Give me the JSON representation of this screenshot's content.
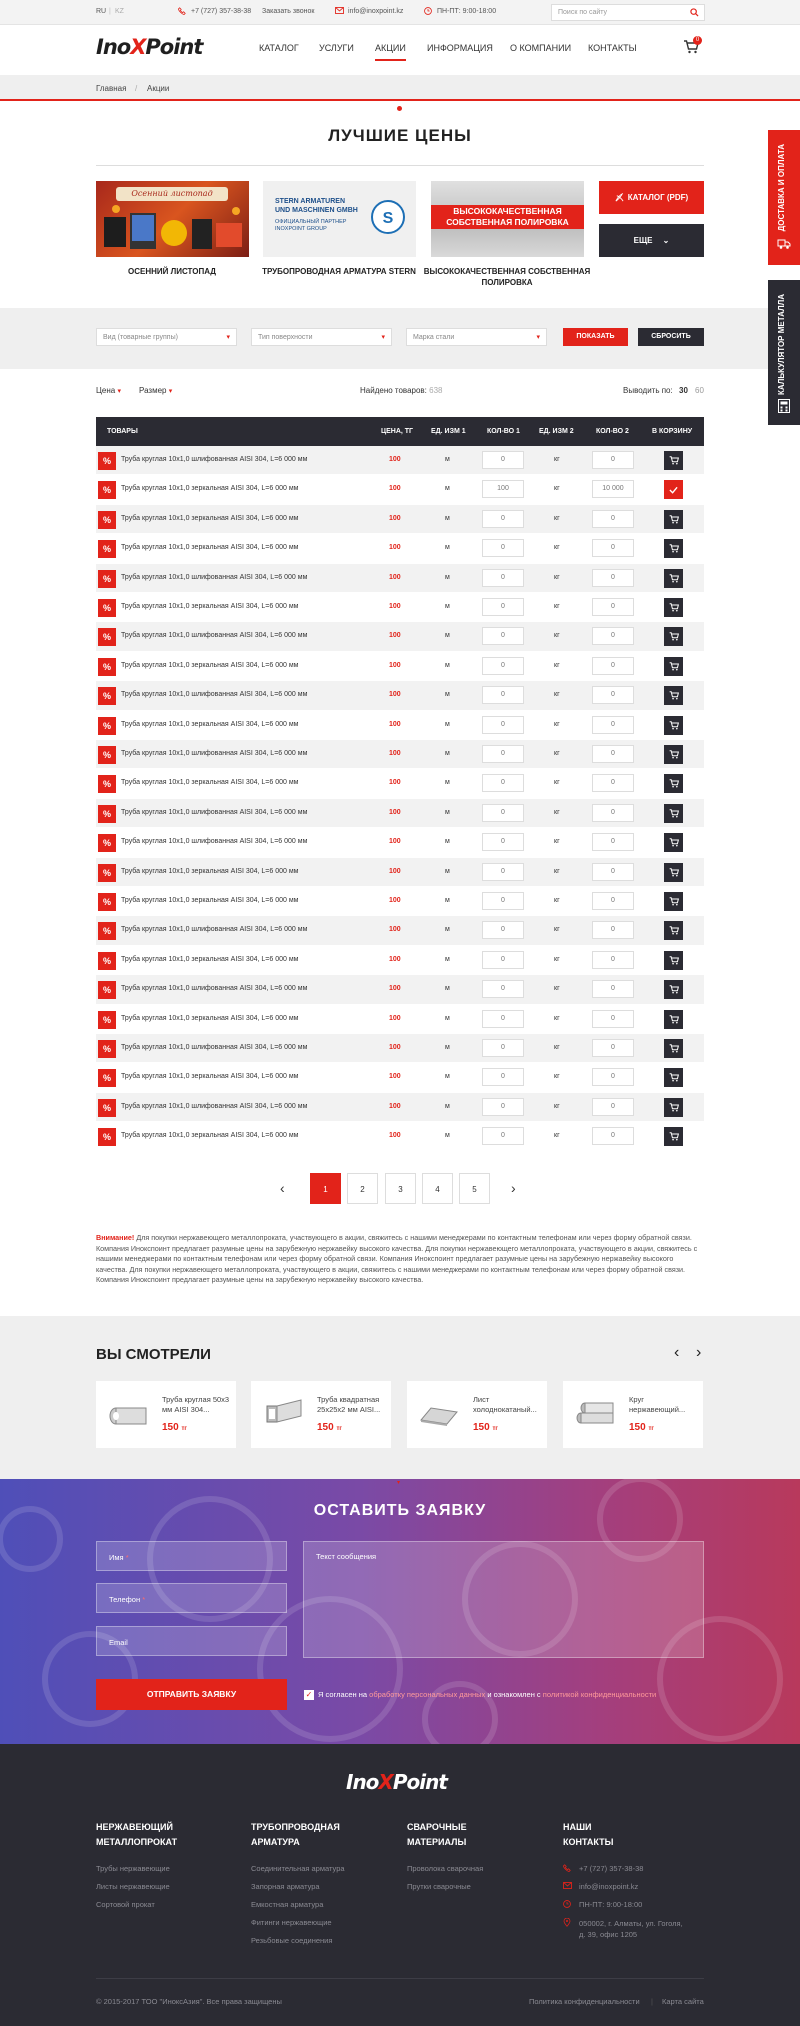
{
  "topbar": {
    "lang_ru": "RU",
    "lang_kz": "KZ",
    "phone": "+7 (727) 357-38-38",
    "callback": "Заказать звонок",
    "email": "info@inoxpoint.kz",
    "hours": "ПН-ПТ: 9:00-18:00",
    "search_placeholder": "Поиск по сайту"
  },
  "logo": {
    "part1": "Ino",
    "x": "X",
    "part2": "Point"
  },
  "nav": [
    "КАТАЛОГ",
    "УСЛУГИ",
    "АКЦИИ",
    "ИНФОРМАЦИЯ",
    "О КОМПАНИИ",
    "КОНТАКТЫ"
  ],
  "cart_count": "0",
  "breadcrumb": {
    "home": "Главная",
    "current": "Акции"
  },
  "page_title": "ЛУЧШИЕ ЦЕНЫ",
  "promos": [
    {
      "caption": "ОСЕННИЙ ЛИСТОПАД",
      "image_text": "Осенний листопад"
    },
    {
      "caption": "ТРУБОПРОВОДНАЯ АРМАТУРА STERN",
      "image_text_1": "STERN ARMATUREN",
      "image_text_2": "UND MASCHINEN GMBH",
      "image_text_3": "ОФИЦИАЛЬНЫЙ ПАРТНЕР",
      "image_text_4": "INOXPOINT GROUP"
    },
    {
      "caption": "ВЫСОКОКАЧЕСТВЕННАЯ СОБСТВЕННАЯ ПОЛИРОВКА",
      "image_text": "ВЫСОКОКАЧЕСТВЕННАЯ СОБСТВЕННАЯ ПОЛИРОВКА"
    }
  ],
  "catalog_button": "КАТАЛОГ (PDF)",
  "more_button": "ЕЩЕ",
  "filters": {
    "group_placeholder": "Вид (товарные группы)",
    "surface_placeholder": "Тип поверхности",
    "steel_placeholder": "Марка стали",
    "show_button": "ПОКАЗАТЬ",
    "reset_button": "СБРОСИТЬ"
  },
  "sort": {
    "price": "Цена",
    "size": "Размер",
    "found_label": "Найдено товаров:",
    "found_count": "638",
    "per_page_label": "Выводить по:",
    "per_page_30": "30",
    "per_page_60": "60"
  },
  "table": {
    "headers": [
      "ТОВАРЫ",
      "ЦЕНА, ТГ",
      "ЕД. ИЗМ 1",
      "КОЛ-ВО 1",
      "ЕД. ИЗМ 2",
      "КОЛ-ВО 2",
      "В КОРЗИНУ"
    ],
    "badge": "%",
    "rows": [
      {
        "name": "Труба круглая 10х1,0 шлифованная AISI 304, L=6 000 мм",
        "price": "100",
        "u1": "м",
        "q1": "0",
        "u2": "кг",
        "q2": "0",
        "in_cart": false
      },
      {
        "name": "Труба круглая 10х1,0 зеркальная AISI 304, L=6 000 мм",
        "price": "100",
        "u1": "м",
        "q1": "100",
        "u2": "кг",
        "q2": "10 000",
        "in_cart": true
      },
      {
        "name": "Труба круглая 10х1,0 зеркальная AISI 304, L=6 000 мм",
        "price": "100",
        "u1": "м",
        "q1": "0",
        "u2": "кг",
        "q2": "0",
        "in_cart": false
      },
      {
        "name": "Труба круглая 10х1,0 зеркальная AISI 304, L=6 000 мм",
        "price": "100",
        "u1": "м",
        "q1": "0",
        "u2": "кг",
        "q2": "0",
        "in_cart": false
      },
      {
        "name": "Труба круглая 10х1,0 шлифованная AISI 304, L=6 000 мм",
        "price": "100",
        "u1": "м",
        "q1": "0",
        "u2": "кг",
        "q2": "0",
        "in_cart": false
      },
      {
        "name": "Труба круглая 10х1,0 зеркальная AISI 304, L=6 000 мм",
        "price": "100",
        "u1": "м",
        "q1": "0",
        "u2": "кг",
        "q2": "0",
        "in_cart": false
      },
      {
        "name": "Труба круглая 10х1,0 шлифованная AISI 304, L=6 000 мм",
        "price": "100",
        "u1": "м",
        "q1": "0",
        "u2": "кг",
        "q2": "0",
        "in_cart": false
      },
      {
        "name": "Труба круглая 10х1,0 зеркальная AISI 304, L=6 000 мм",
        "price": "100",
        "u1": "м",
        "q1": "0",
        "u2": "кг",
        "q2": "0",
        "in_cart": false
      },
      {
        "name": "Труба круглая 10х1,0 шлифованная AISI 304, L=6 000 мм",
        "price": "100",
        "u1": "м",
        "q1": "0",
        "u2": "кг",
        "q2": "0",
        "in_cart": false
      },
      {
        "name": "Труба круглая 10х1,0 зеркальная AISI 304, L=6 000 мм",
        "price": "100",
        "u1": "м",
        "q1": "0",
        "u2": "кг",
        "q2": "0",
        "in_cart": false
      },
      {
        "name": "Труба круглая 10х1,0 шлифованная AISI 304, L=6 000 мм",
        "price": "100",
        "u1": "м",
        "q1": "0",
        "u2": "кг",
        "q2": "0",
        "in_cart": false
      },
      {
        "name": "Труба круглая 10х1,0 зеркальная AISI 304, L=6 000 мм",
        "price": "100",
        "u1": "м",
        "q1": "0",
        "u2": "кг",
        "q2": "0",
        "in_cart": false
      },
      {
        "name": "Труба круглая 10х1,0 шлифованная AISI 304, L=6 000 мм",
        "price": "100",
        "u1": "м",
        "q1": "0",
        "u2": "кг",
        "q2": "0",
        "in_cart": false
      },
      {
        "name": "Труба круглая 10х1,0 шлифованная AISI 304, L=6 000 мм",
        "price": "100",
        "u1": "м",
        "q1": "0",
        "u2": "кг",
        "q2": "0",
        "in_cart": false
      },
      {
        "name": "Труба круглая 10х1,0 зеркальная AISI 304, L=6 000 мм",
        "price": "100",
        "u1": "м",
        "q1": "0",
        "u2": "кг",
        "q2": "0",
        "in_cart": false
      },
      {
        "name": "Труба круглая 10х1,0 зеркальная AISI 304, L=6 000 мм",
        "price": "100",
        "u1": "м",
        "q1": "0",
        "u2": "кг",
        "q2": "0",
        "in_cart": false
      },
      {
        "name": "Труба круглая 10х1,0 шлифованная AISI 304, L=6 000 мм",
        "price": "100",
        "u1": "м",
        "q1": "0",
        "u2": "кг",
        "q2": "0",
        "in_cart": false
      },
      {
        "name": "Труба круглая 10х1,0 зеркальная AISI 304, L=6 000 мм",
        "price": "100",
        "u1": "м",
        "q1": "0",
        "u2": "кг",
        "q2": "0",
        "in_cart": false
      },
      {
        "name": "Труба круглая 10х1,0 шлифованная AISI 304, L=6 000 мм",
        "price": "100",
        "u1": "м",
        "q1": "0",
        "u2": "кг",
        "q2": "0",
        "in_cart": false
      },
      {
        "name": "Труба круглая 10х1,0 зеркальная AISI 304, L=6 000 мм",
        "price": "100",
        "u1": "м",
        "q1": "0",
        "u2": "кг",
        "q2": "0",
        "in_cart": false
      },
      {
        "name": "Труба круглая 10х1,0 шлифованная AISI 304, L=6 000 мм",
        "price": "100",
        "u1": "м",
        "q1": "0",
        "u2": "кг",
        "q2": "0",
        "in_cart": false
      },
      {
        "name": "Труба круглая 10х1,0 зеркальная AISI 304, L=6 000 мм",
        "price": "100",
        "u1": "м",
        "q1": "0",
        "u2": "кг",
        "q2": "0",
        "in_cart": false
      },
      {
        "name": "Труба круглая 10х1,0 шлифованная AISI 304, L=6 000 мм",
        "price": "100",
        "u1": "м",
        "q1": "0",
        "u2": "кг",
        "q2": "0",
        "in_cart": false
      },
      {
        "name": "Труба круглая 10х1,0 зеркальная AISI 304, L=6 000 мм",
        "price": "100",
        "u1": "м",
        "q1": "0",
        "u2": "кг",
        "q2": "0",
        "in_cart": false
      }
    ]
  },
  "pagination": [
    "1",
    "2",
    "3",
    "4",
    "5"
  ],
  "notice": {
    "bold": "Внимание!",
    "text": " Для покупки нержавеющего металлопроката, участвующего в акции, свяжитесь с нашими менеджерами по контактным телефонам или через форму обратной связи. Компания Инокспоинт предлагает разумные цены на зарубежную нержавейку высокого качества. Для покупки нержавеющего металлопроката, участвующего в акции, свяжитесь с нашими менеджерами по контактным телефонам или через форму обратной связи. Компания Инокспоинт предлагает разумные цены на зарубежную нержавейку высокого качества. Для покупки нержавеющего металлопроката, участвующего в акции, свяжитесь с нашими менеджерами по контактным телефонам или через форму обратной связи. Компания Инокспоинт предлагает разумные цены на зарубежную нержавейку высокого качества."
  },
  "viewed": {
    "title": "ВЫ СМОТРЕЛИ",
    "items": [
      {
        "name": "Труба круглая 50х3 мм AISI 304...",
        "price": "150",
        "cur": "тг"
      },
      {
        "name": "Труба квадратная 25х25х2 мм AISI...",
        "price": "150",
        "cur": "тг"
      },
      {
        "name": "Лист холоднокатаный...",
        "price": "150",
        "cur": "тг"
      },
      {
        "name": "Круг нержавеющий...",
        "price": "150",
        "cur": "тг"
      }
    ]
  },
  "request": {
    "title": "ОСТАВИТЬ ЗАЯВКУ",
    "name": "Имя",
    "phone": "Телефон",
    "email": "Email",
    "message": "Текст сообщения",
    "submit": "ОТПРАВИТЬ ЗАЯВКУ",
    "agree_1": "Я согласен на ",
    "agree_link1": "обработку персональных данных",
    "agree_2": " и ознакомлен с ",
    "agree_link2": "политикой конфиденциальности"
  },
  "footer": {
    "col1": {
      "title_1": "НЕРЖАВЕЮЩИЙ",
      "title_2": "МЕТАЛЛОПРОКАТ",
      "links": [
        "Трубы нержавеющие",
        "Листы нержавеющие",
        "Сортовой прокат"
      ]
    },
    "col2": {
      "title_1": "ТРУБОПРОВОДНАЯ",
      "title_2": "АРМАТУРА",
      "links": [
        "Соединительная арматура",
        "Запорная арматура",
        "Емкостная арматура",
        "Фитинги нержавеющие",
        "Резьбовые соединения"
      ]
    },
    "col3": {
      "title_1": "СВАРОЧНЫЕ",
      "title_2": "МАТЕРИАЛЫ",
      "links": [
        "Проволока сварочная",
        "Прутки сварочные"
      ]
    },
    "col4": {
      "title_1": "НАШИ",
      "title_2": "КОНТАКТЫ",
      "phone": "+7 (727) 357-38-38",
      "email": "info@inoxpoint.kz",
      "hours": "ПН-ПТ: 9:00-18:00",
      "address": "050002, г. Алматы, ул. Гоголя, д. 39, офис 1205"
    },
    "copyright": "© 2015-2017 ТОО \"ИноксАзия\". Все права защищены",
    "privacy": "Политика конфиденциальности",
    "sitemap": "Карта сайта"
  },
  "side_tabs": {
    "delivery": "ДОСТАВКА И ОПЛАТА",
    "calculator": "КАЛЬКУЛЯТОР МЕТАЛЛА"
  }
}
